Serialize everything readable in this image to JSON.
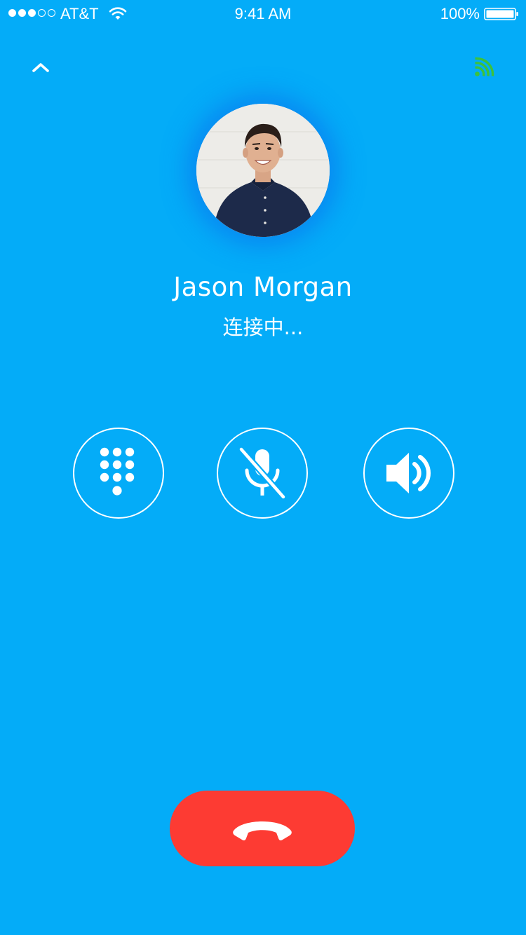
{
  "status_bar": {
    "signal_bars_filled": 3,
    "signal_bars_total": 5,
    "carrier": "AT&T",
    "time": "9:41 AM",
    "battery_percent": "100%",
    "battery_level": 1.0,
    "wifi_icon": "wifi-icon"
  },
  "header": {
    "collapse_icon": "chevron-up-icon",
    "signal_quality_icon": "signal-strength-icon",
    "signal_quality_color": "#3DC23A"
  },
  "call": {
    "caller_name": "Jason Morgan",
    "status": "连接中..."
  },
  "controls": [
    {
      "id": "keypad",
      "icon": "dialpad-icon"
    },
    {
      "id": "mute",
      "icon": "microphone-muted-icon"
    },
    {
      "id": "speaker",
      "icon": "speaker-icon"
    }
  ],
  "end_call": {
    "icon": "phone-hangup-icon",
    "color": "#FD3B33"
  },
  "theme": {
    "background": "#04ACF8",
    "foreground": "#FFFFFF"
  }
}
